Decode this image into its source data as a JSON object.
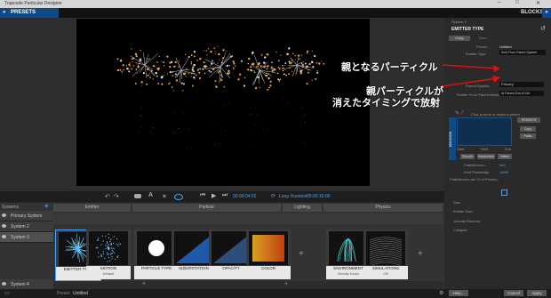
{
  "window": {
    "title": "Trapcode Particular Designer",
    "minimize": "–",
    "maximize": "□",
    "close": "✕"
  },
  "toolbar": {
    "presets_label": "PRESETS",
    "blocks_label": "BLOCKS"
  },
  "transport": {
    "current_time": "00:00:04:01",
    "loop_label": "Loop Duration:",
    "loop_time": "00:00:10:00"
  },
  "right_panel": {
    "system_label": "System 3",
    "section_title": "EMITTER TYPE",
    "tabs": [
      "Copy",
      "Save"
    ],
    "preset_label": "Preset:",
    "preset_value": "Untitled",
    "emitter_type_label": "Emitter Type:",
    "emitter_type_value": "Emit From Parent System",
    "parent_system_label": "Parent System:",
    "parent_system_value": "Primary",
    "emitter_behavior_label": "Emitter From Parent Behavior:",
    "emitter_behavior_value": "At Parent End of Life",
    "curve_hint": "Click a curve or select a preset",
    "presets_btn": "PRESETS",
    "copy_btn": "Copy",
    "paste_btn": "Paste",
    "emission_tab": "EMISSION",
    "start_label": "Start",
    "time_label": "TIME",
    "end_label": "End",
    "smooth_btn": "Smooth",
    "randomize_btn": "Randomize",
    "flatten_btn": "Flatten",
    "particles_label": "Particles/sec:",
    "particles_value": "400",
    "emit_prob_label": "Emit Probability:",
    "emit_prob_value": "100%",
    "particles_per_label": "Particles/sec per % of Primary:",
    "size_label": "Size",
    "emitter_size_label": "Emitter Size:",
    "velocity_label": "Velocity Random:",
    "collapse_label": "Collapse"
  },
  "annotations": {
    "line1": "親となるパーティクル",
    "line2a": "親パーティクルが",
    "line2b": "消えたタイミングで放射"
  },
  "systems": {
    "header": "Systems",
    "items": [
      "Primary System",
      "System 2",
      "System 3",
      "System 4"
    ]
  },
  "categories": [
    "Emitter",
    "Particle",
    "Lighting",
    "Physics"
  ],
  "tiles": [
    {
      "title": "EMITTER TYPE",
      "sub": ""
    },
    {
      "title": "MOTION",
      "sub": "Default"
    },
    {
      "title": "PARTICLE TYPE",
      "sub": ""
    },
    {
      "title": "SIZE/ROTATION",
      "sub": ""
    },
    {
      "title": "OPACITY",
      "sub": ""
    },
    {
      "title": "COLOR",
      "sub": ""
    },
    {
      "title": "ENVIRONMENT",
      "sub": "Gravity Down"
    },
    {
      "title": "SIMULATIONS",
      "sub": "Off"
    }
  ],
  "status": {
    "preset_label": "Preset:",
    "preset_value": "Untitled",
    "help": "Help...",
    "cancel": "Cancel",
    "apply": "Apply"
  },
  "colors": {
    "accent": "#0f4a86",
    "highlight": "#4aa3ff",
    "spark": "#f0a030"
  }
}
